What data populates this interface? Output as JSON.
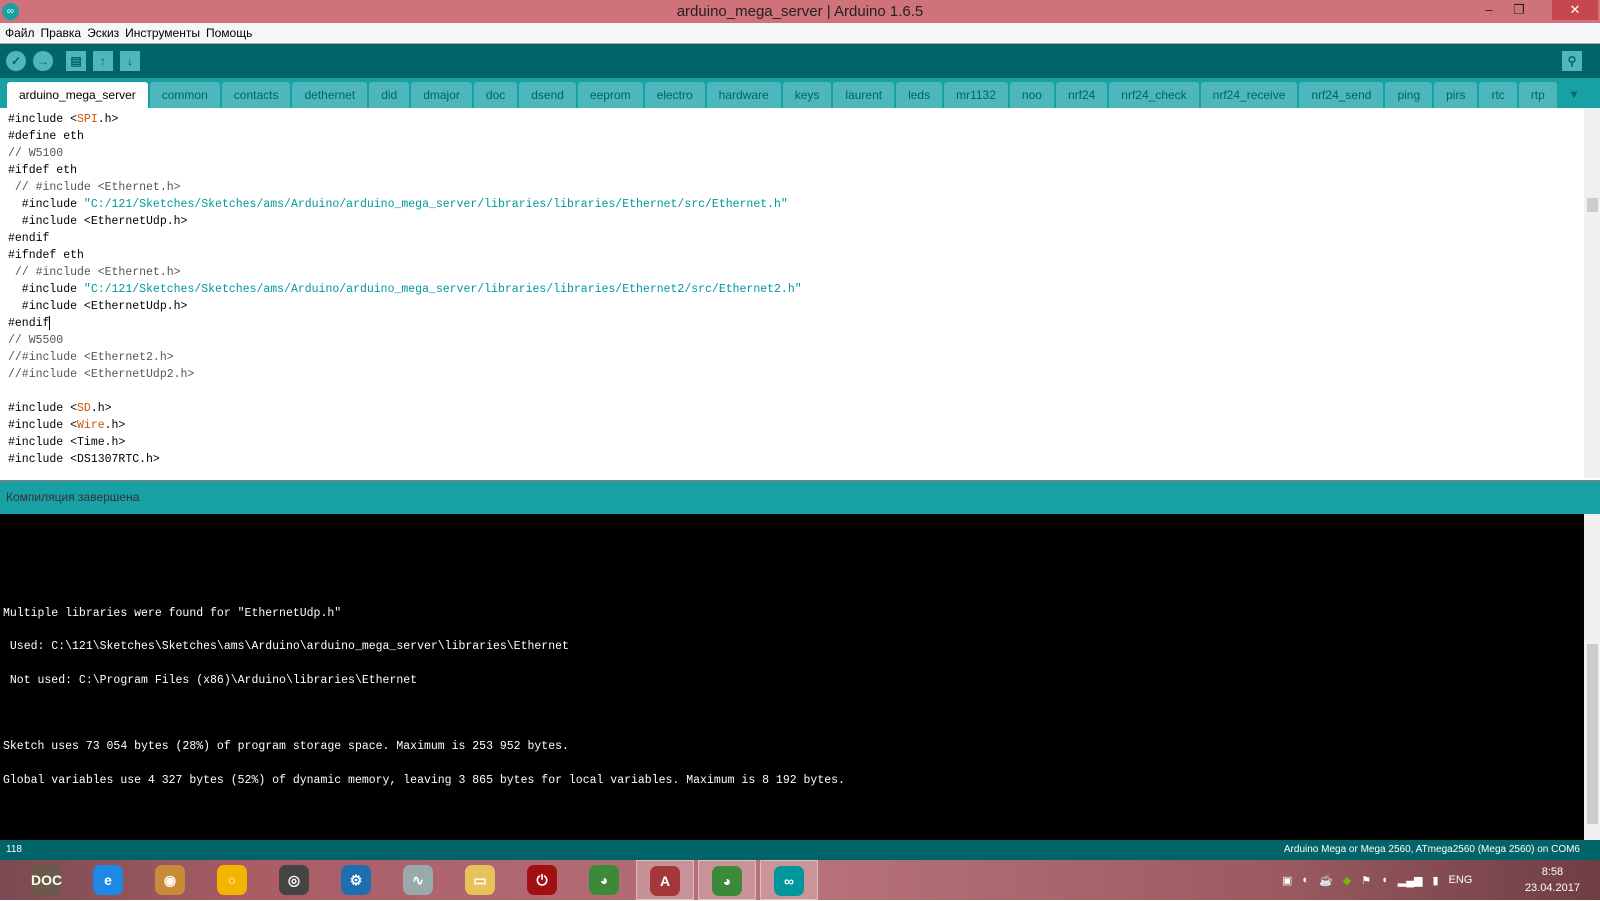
{
  "window": {
    "title": "arduino_mega_server | Arduino 1.6.5",
    "minimize": "‒",
    "restore": "❐",
    "close": "✕"
  },
  "menu": [
    "Файл",
    "Правка",
    "Эскиз",
    "Инструменты",
    "Помощь"
  ],
  "toolbar": {
    "verify": "✓",
    "upload": "→",
    "new": "▤",
    "open": "↑",
    "save": "↓",
    "serial_monitor": "⚲"
  },
  "tabs": [
    "arduino_mega_server",
    "common",
    "contacts",
    "dethernet",
    "did",
    "dmajor",
    "doc",
    "dsend",
    "eeprom",
    "electro",
    "hardware",
    "keys",
    "laurent",
    "leds",
    "mr1132",
    "noo",
    "nrf24",
    "nrf24_check",
    "nrf24_receive",
    "nrf24_send",
    "ping",
    "pirs",
    "rtc",
    "rtp"
  ],
  "tabs_menu": "▼",
  "code": [
    [
      [
        "#include <",
        ""
      ],
      [
        "SPI",
        "k"
      ],
      [
        ".h>",
        ""
      ]
    ],
    [
      [
        "#define eth",
        ""
      ]
    ],
    [
      [
        "// W5100",
        "c"
      ]
    ],
    [
      [
        "#ifdef eth",
        ""
      ]
    ],
    [
      [
        " // #include <Ethernet.h>",
        "c"
      ]
    ],
    [
      [
        "  #include ",
        ""
      ],
      [
        "\"C:/121/Sketches/Sketches/ams/Arduino/arduino_mega_server/libraries/libraries/Ethernet/src/Ethernet.h\"",
        "s"
      ]
    ],
    [
      [
        "  #include <EthernetUdp.h>",
        ""
      ]
    ],
    [
      [
        "#endif",
        ""
      ]
    ],
    [
      [
        "#ifndef eth",
        ""
      ]
    ],
    [
      [
        " // #include <Ethernet.h>",
        "c"
      ]
    ],
    [
      [
        "  #include ",
        ""
      ],
      [
        "\"C:/121/Sketches/Sketches/ams/Arduino/arduino_mega_server/libraries/libraries/Ethernet2/src/Ethernet2.h\"",
        "s"
      ]
    ],
    [
      [
        "  #include <EthernetUdp.h>",
        ""
      ]
    ],
    [
      [
        "#endif",
        ""
      ]
    ],
    [
      [
        "// W5500",
        "c"
      ]
    ],
    [
      [
        "//#include <Ethernet2.h>",
        "c"
      ]
    ],
    [
      [
        "//#include <EthernetUdp2.h>",
        "c"
      ]
    ],
    [
      [
        "",
        ""
      ]
    ],
    [
      [
        "#include <",
        ""
      ],
      [
        "SD",
        "k"
      ],
      [
        ".h>",
        ""
      ]
    ],
    [
      [
        "#include <",
        ""
      ],
      [
        "Wire",
        "k"
      ],
      [
        ".h>",
        ""
      ]
    ],
    [
      [
        "#include <Time.h>",
        ""
      ]
    ],
    [
      [
        "#include <DS1307RTC.h>",
        ""
      ]
    ]
  ],
  "status": "Компиляция завершена",
  "console": [
    "Multiple libraries were found for \"EthernetUdp.h\"",
    " Used: C:\\121\\Sketches\\Sketches\\ams\\Arduino\\arduino_mega_server\\libraries\\Ethernet",
    " Not used: C:\\Program Files (x86)\\Arduino\\libraries\\Ethernet",
    "Sketch uses 73 054 bytes (28%) of program storage space. Maximum is 253 952 bytes.",
    "Global variables use 4 327 bytes (52%) of dynamic memory, leaving 3 865 bytes for local variables. Maximum is 8 192 bytes."
  ],
  "bottom": {
    "line": "118",
    "board": "Arduino Mega or Mega 2560, ATmega2560 (Mega 2560) on COM6"
  },
  "taskbar": {
    "apps": [
      {
        "name": "doc-app",
        "glyph": "DOC",
        "color": "#6b5a4a"
      },
      {
        "name": "internet-explorer",
        "glyph": "e",
        "color": "#1e88e5"
      },
      {
        "name": "image-app",
        "glyph": "◉",
        "color": "#c98a3a"
      },
      {
        "name": "chrome-canary",
        "glyph": "○",
        "color": "#f5b400"
      },
      {
        "name": "speaker-app",
        "glyph": "◎",
        "color": "#444"
      },
      {
        "name": "settings-app",
        "glyph": "⚙",
        "color": "#1e6fb0"
      },
      {
        "name": "monitor-app",
        "glyph": "∿",
        "color": "#9aa"
      },
      {
        "name": "file-explorer",
        "glyph": "▭",
        "color": "#e8c25a"
      },
      {
        "name": "power-app",
        "glyph": "⏻",
        "color": "#a01010"
      },
      {
        "name": "chrome",
        "glyph": "◕",
        "color": "#3a8a3a"
      },
      {
        "name": "access",
        "glyph": "A",
        "color": "#a4373a"
      },
      {
        "name": "chrome-user",
        "glyph": "◕",
        "color": "#3a8a3a"
      },
      {
        "name": "arduino",
        "glyph": "∞",
        "color": "#00979c"
      }
    ],
    "lang": "ENG",
    "time": "8:58",
    "date": "23.04.2017"
  }
}
